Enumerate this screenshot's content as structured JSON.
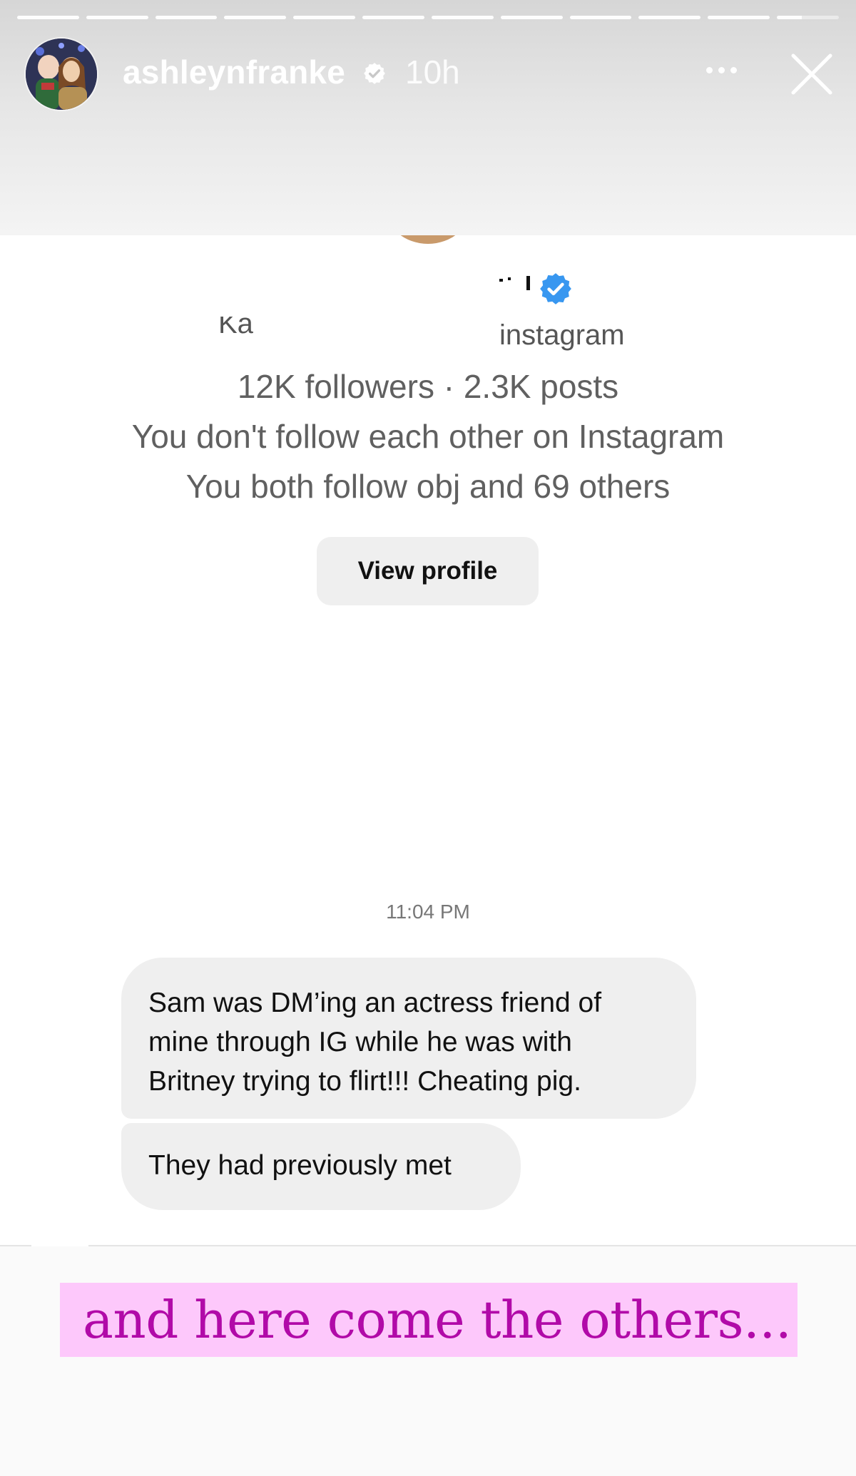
{
  "story": {
    "username": "ashleynfranke",
    "time_ago": "10h",
    "verified": true,
    "progress_segments": 12,
    "current_segment": 12,
    "current_segment_progress": 0.4
  },
  "icons": {
    "verified_small": "verified-badge-icon",
    "more": "more-options-icon",
    "close": "close-icon",
    "verified_blue": "verified-badge-icon"
  },
  "profile": {
    "name_fragment": "' '",
    "handle_fragment_left": "Ka",
    "handle_fragment_right": "instagram",
    "stats": "12K followers · 2.3K posts",
    "follow_status": "You don't follow each other on Instagram",
    "mutuals": "You both follow obj and 69 others",
    "view_profile_label": "View profile"
  },
  "conversation": {
    "timestamp": "11:04 PM",
    "messages": [
      {
        "lines": [
          "Sam was DM’ing an actress friend of",
          "mine through IG while he was with",
          "Britney trying to flirt!!! Cheating pig."
        ]
      },
      {
        "text": "They had previously met"
      }
    ]
  },
  "caption": {
    "text": "and here come the others...",
    "text_color": "#b10aa8",
    "highlight_color": "#fdc8fb"
  },
  "colors": {
    "bubble": "#efefef",
    "verified_blue": "#3897f0",
    "secondary_text": "#606060"
  }
}
